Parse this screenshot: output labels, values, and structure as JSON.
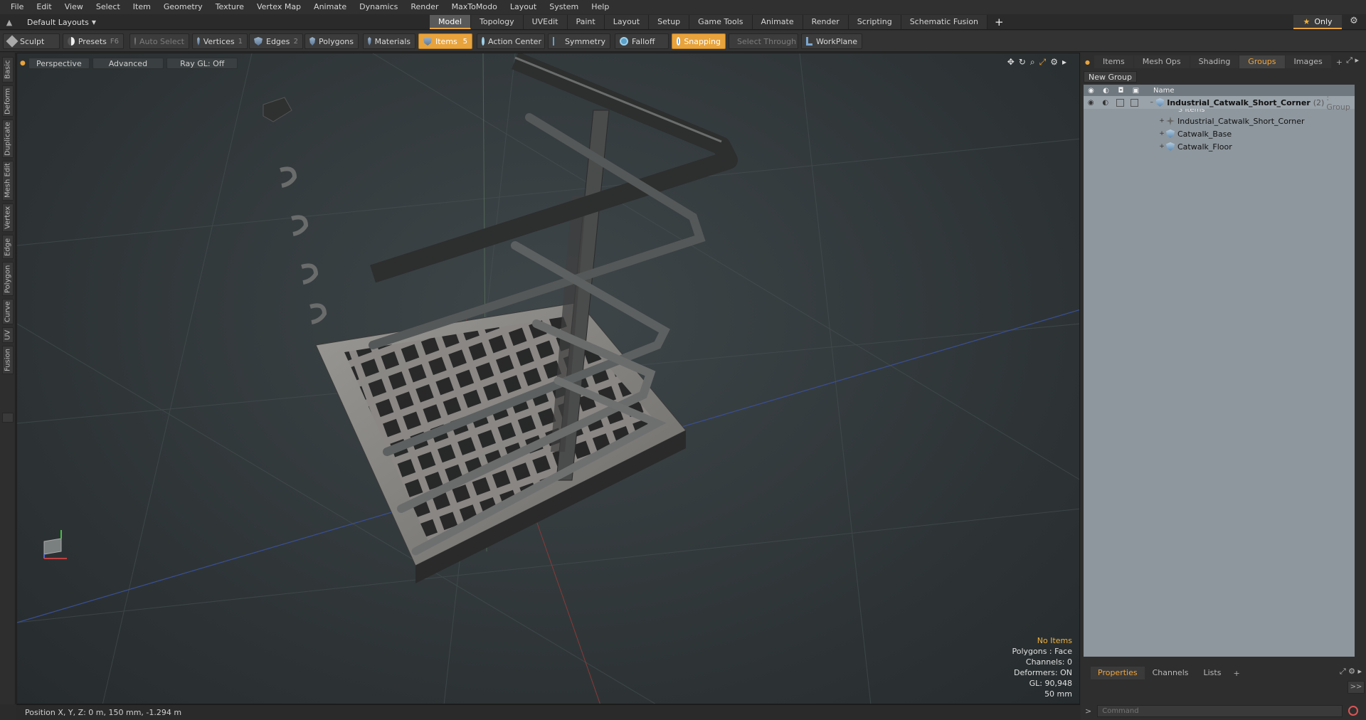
{
  "menu": [
    "File",
    "Edit",
    "View",
    "Select",
    "Item",
    "Geometry",
    "Texture",
    "Vertex Map",
    "Animate",
    "Dynamics",
    "Render",
    "MaxToModo",
    "Layout",
    "System",
    "Help"
  ],
  "layout_selector": "Default Layouts",
  "tabs": [
    "Model",
    "Topology",
    "UVEdit",
    "Paint",
    "Layout",
    "Setup",
    "Game Tools",
    "Animate",
    "Render",
    "Scripting",
    "Schematic Fusion"
  ],
  "active_tab": "Model",
  "only_label": "Only",
  "toolbar": {
    "sculpt": "Sculpt",
    "presets": "Presets",
    "presets_key": "F6",
    "auto_select": "Auto Select",
    "vertices": "Vertices",
    "vertices_count": "1",
    "edges": "Edges",
    "edges_count": "2",
    "polygons": "Polygons",
    "materials": "Materials",
    "items": "Items",
    "items_count": "5",
    "action_center": "Action Center",
    "symmetry": "Symmetry",
    "falloff": "Falloff",
    "snapping": "Snapping",
    "select_through": "Select Through",
    "workplane": "WorkPlane"
  },
  "left_tabs": [
    "Basic",
    "Deform",
    "Duplicate",
    "Mesh Edit",
    "Vertex",
    "Edge",
    "Polygon",
    "Curve",
    "UV",
    "Fusion"
  ],
  "viewport": {
    "view": "Perspective",
    "shading": "Advanced",
    "raygl": "Ray GL: Off",
    "info": {
      "no_items": "No Items",
      "polygons": "Polygons : Face",
      "channels": "Channels: 0",
      "deformers": "Deformers: ON",
      "gl": "GL: 90,948",
      "grid": "50 mm"
    }
  },
  "status": "Position X, Y, Z:  0 m, 150 mm, -1.294 m",
  "right_panel": {
    "tabs": [
      "Items",
      "Mesh Ops",
      "Shading",
      "Groups",
      "Images"
    ],
    "active_tab": "Groups",
    "new_group": "New Group",
    "column_name": "Name",
    "group": {
      "name": "Industrial_Catwalk_Short_Corner",
      "count": "(2)",
      "type": ": Group",
      "items_label": "3 Items",
      "children": [
        "Industrial_Catwalk_Short_Corner",
        "Catwalk_Base",
        "Catwalk_Floor"
      ]
    },
    "bottom_tabs": [
      "Properties",
      "Channels",
      "Lists"
    ],
    "active_bottom_tab": "Properties",
    "command_placeholder": "Command"
  },
  "colors": {
    "accent": "#e8a33c",
    "viewport_bg": "#2d3335",
    "list_bg": "#8e979e"
  }
}
